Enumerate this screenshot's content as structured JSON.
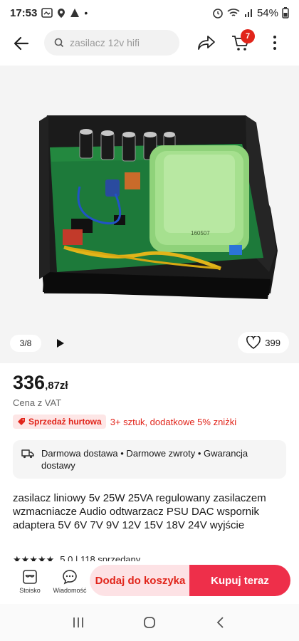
{
  "status": {
    "time": "17:53",
    "battery": "54%"
  },
  "search": {
    "placeholder": "zasilacz 12v hifi"
  },
  "cart": {
    "count": "7"
  },
  "gallery": {
    "counter": "3/8",
    "likes": "399",
    "board_label": "160507"
  },
  "product": {
    "price_int": "336",
    "price_dec": ",87zł",
    "vat": "Cena z VAT",
    "promo_tag": "Sprzedaż hurtowa",
    "promo_text": "3+ sztuk, dodatkowe 5% zniżki",
    "shipping": "Darmowa dostawa • Darmowe zwroty • Gwarancja dostawy",
    "title": "zasilacz liniowy 5v 25W 25VA regulowany zasilaczem wzmacniacze Audio odtwarzacz PSU DAC wspornik adaptera 5V 6V 7V 9V 12V 15V 18V 24V wyjście",
    "rating_text": "5.0 | 118 sprzedany"
  },
  "bottom": {
    "store": "Stoisko",
    "messages": "Wiadomość",
    "add_cart": "Dodaj do koszyka",
    "buy_now": "Kupuj teraz"
  },
  "colors": {
    "accent": "#ee2f4a",
    "accent_light": "#fde2e5",
    "promo_red": "#e1251b"
  }
}
